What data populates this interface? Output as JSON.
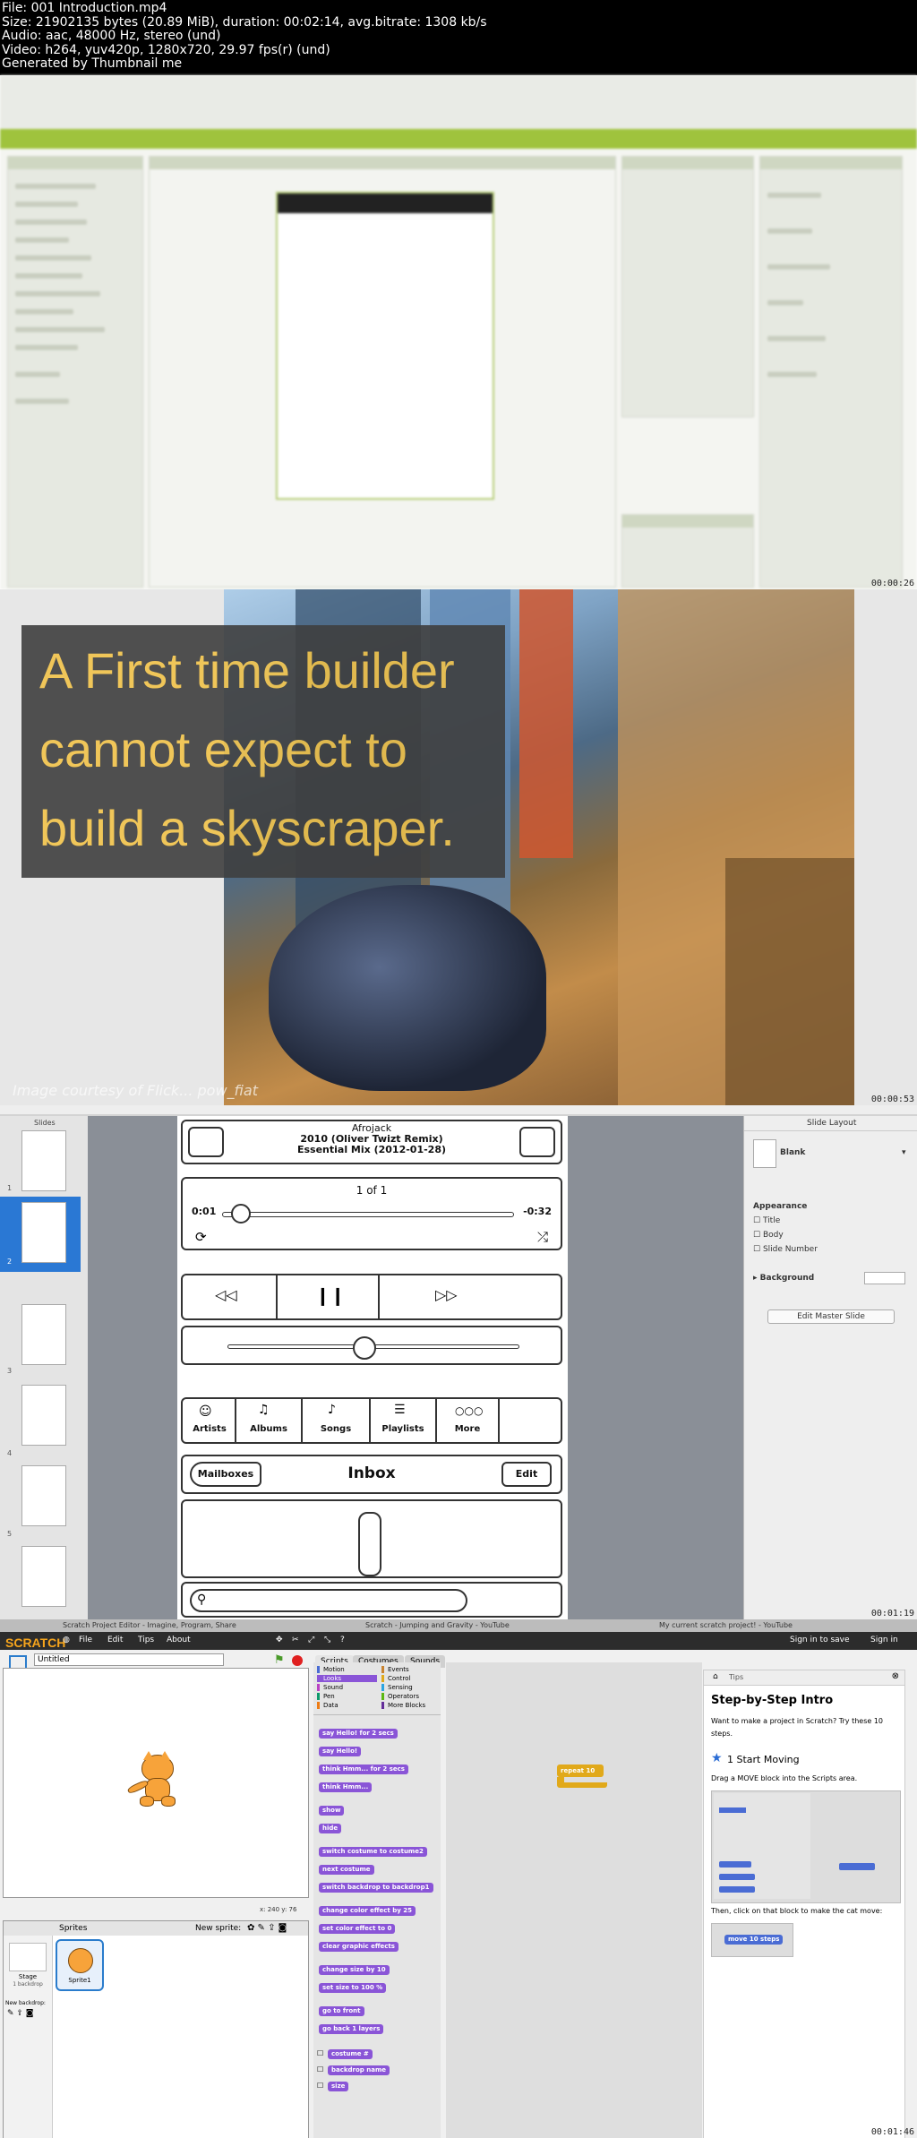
{
  "header": {
    "lines": [
      "File: 001 Introduction.mp4",
      "Size: 21902135 bytes (20.89 MiB), duration: 00:02:14, avg.bitrate: 1308 kb/s",
      "Audio: aac, 48000 Hz, stereo (und)",
      "Video: h264, yuv420p, 1280x720, 29.97 fps(r) (und)",
      "Generated by Thumbnail me"
    ]
  },
  "timestamps": [
    "00:00:26",
    "00:00:53",
    "00:01:19",
    "00:01:46"
  ],
  "slide": {
    "lines": [
      "A First time builder",
      "cannot expect to",
      "build a skyscraper."
    ],
    "credit": "Image courtesy of Flick... pow_fiat",
    "colors": {
      "text": "#f2c34a",
      "box": "#3f3f3f"
    }
  },
  "keynote": {
    "panel_title": "Slide Layout",
    "layout": "Blank",
    "appearance": "Appearance",
    "checks": [
      "Title",
      "Body",
      "Slide Number"
    ],
    "background": "Background",
    "edit_master": "Edit Master Slide",
    "slides_label": "Slides",
    "mock": {
      "artist": "Afrojack",
      "track": "2010 (Oliver Twizt Remix)",
      "album": "Essential Mix (2012-01-28)",
      "count": "1 of 1",
      "time_left": "0:01",
      "time_right": "-0:32",
      "tabs": [
        "Artists",
        "Albums",
        "Songs",
        "Playlists",
        "More"
      ],
      "mailboxes": "Mailboxes",
      "inbox": "Inbox",
      "edit": "Edit"
    }
  },
  "scratch": {
    "browser_tabs": [
      "Scratch Project Editor - Imagine, Program, Share",
      "Scratch - Jumping and Gravity - YouTube",
      "My current scratch project! - YouTube"
    ],
    "logo": "SCRATCH",
    "menu": [
      "File",
      "Edit",
      "Tips",
      "About"
    ],
    "signin": "Sign in to save",
    "signin2": "Sign in",
    "project_title": "Untitled",
    "tabs": [
      "Scripts",
      "Costumes",
      "Sounds"
    ],
    "categories_left": [
      "Motion",
      "Looks",
      "Sound",
      "Pen",
      "Data"
    ],
    "categories_right": [
      "Events",
      "Control",
      "Sensing",
      "Operators",
      "More Blocks"
    ],
    "blocks": [
      "say Hello! for 2 secs",
      "say Hello!",
      "think Hmm... for 2 secs",
      "think Hmm...",
      "show",
      "hide",
      "switch costume to costume2",
      "next costume",
      "switch backdrop to backdrop1",
      "change color effect by 25",
      "set color effect to 0",
      "clear graphic effects",
      "change size by 10",
      "set size to 100 %",
      "go to front",
      "go back 1 layers",
      "costume #",
      "backdrop name",
      "size"
    ],
    "script_block": "repeat 10",
    "coords": "x: 240  y: 76",
    "sprites_label": "Sprites",
    "new_sprite": "New sprite:",
    "stage_label": "Stage",
    "stage_sub": "1 backdrop",
    "new_backdrop": "New backdrop:",
    "sprite_name": "Sprite1",
    "tips": {
      "header": "Tips",
      "title": "Step-by-Step Intro",
      "intro": "Want to make a project in Scratch? Try these 10 steps.",
      "step": "1 Start Moving",
      "step_text": "Drag a MOVE block into the Scripts area.",
      "then": "Then, click on that block to make the cat move:",
      "move": "move 10 steps"
    }
  }
}
